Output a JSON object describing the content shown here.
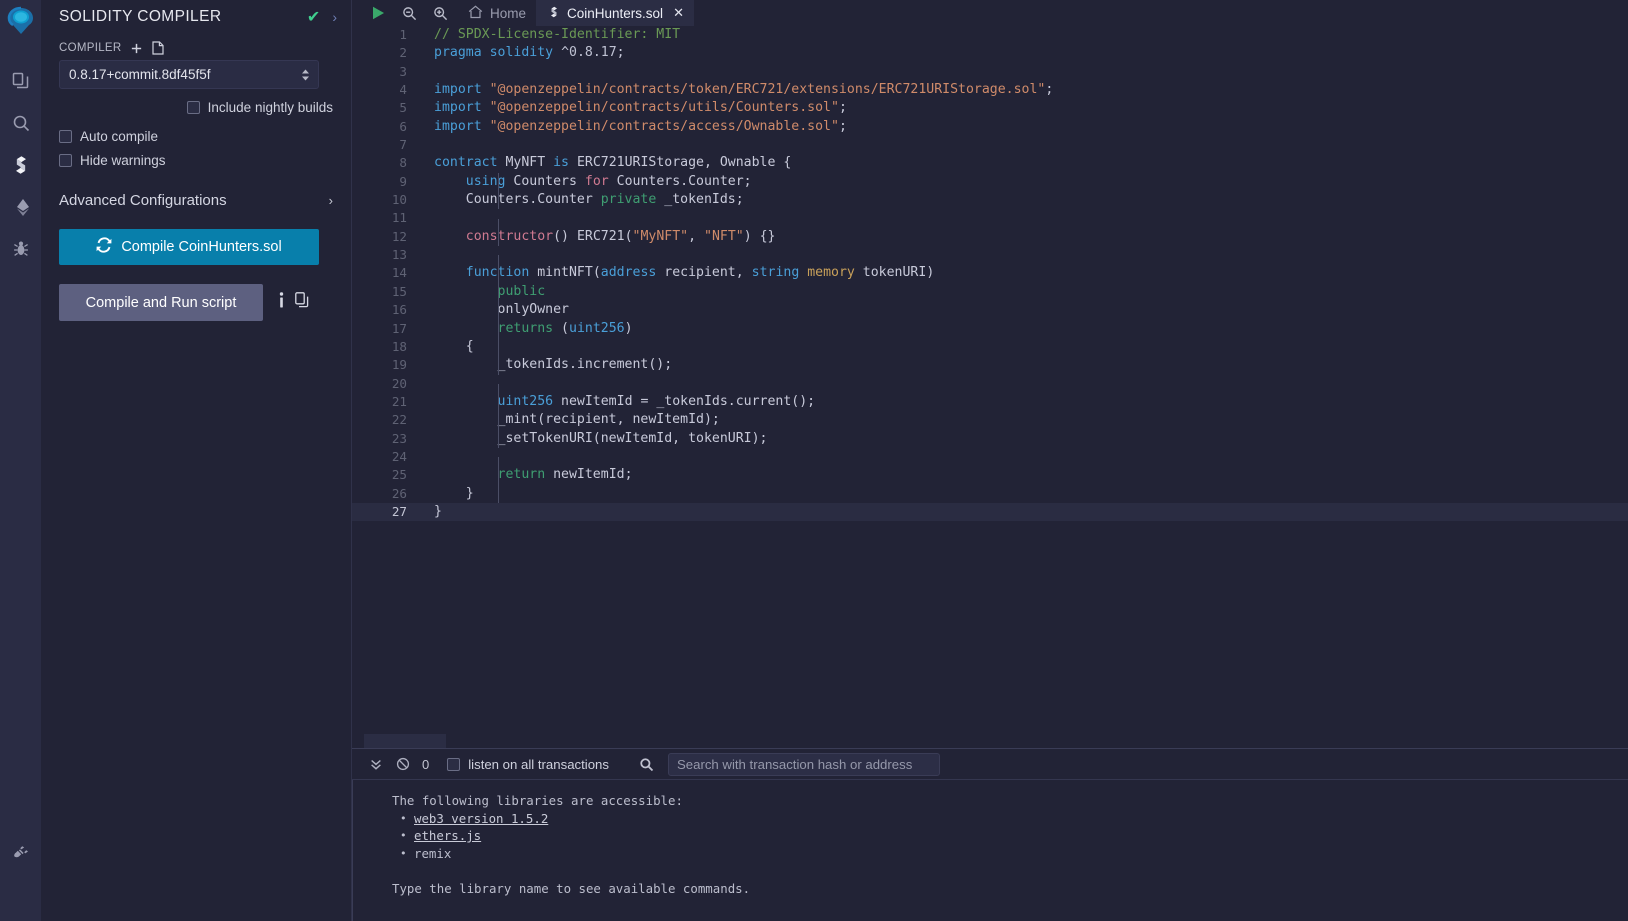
{
  "rail": {
    "logo": "remix-logo",
    "items": [
      {
        "name": "file-explorer-icon",
        "title": "File explorer"
      },
      {
        "name": "search-icon",
        "title": "Search in files"
      },
      {
        "name": "solidity-compiler-icon",
        "title": "Solidity compiler"
      },
      {
        "name": "deploy-run-icon",
        "title": "Deploy & run transactions"
      },
      {
        "name": "debugger-icon",
        "title": "Debugger"
      }
    ],
    "bottom": {
      "name": "plugin-manager-icon",
      "title": "Plugin manager"
    }
  },
  "panel": {
    "title": "SOLIDITY COMPILER",
    "status_check": "✔",
    "expand_chevron": "›",
    "compiler_label": "COMPILER",
    "add_icon": "+",
    "file_icon": "document-icon",
    "compiler_version": "0.8.17+commit.8df45f5f",
    "nightly_label": "Include nightly builds",
    "auto_compile_label": "Auto compile",
    "hide_warnings_label": "Hide warnings",
    "advanced_label": "Advanced Configurations",
    "advanced_chevron": "›",
    "compile_button": "Compile CoinHunters.sol",
    "run_script_button": "Compile and Run script",
    "info_icon": "info-icon",
    "copy_icon": "copy-icon"
  },
  "toolbar": {
    "run_icon": "play-icon",
    "zoom_out_icon": "zoom-out-icon",
    "zoom_in_icon": "zoom-in-icon",
    "tabs": [
      {
        "label": "Home",
        "icon": "home-icon",
        "active": false,
        "closable": false
      },
      {
        "label": "CoinHunters.sol",
        "icon": "solidity-file-icon",
        "active": true,
        "closable": true,
        "close": "✕"
      }
    ]
  },
  "editor": {
    "active_line": 27,
    "lines": [
      {
        "n": 1,
        "tokens": [
          {
            "t": "com",
            "v": "// SPDX-License-Identifier: MIT"
          }
        ]
      },
      {
        "n": 2,
        "tokens": [
          {
            "t": "kw",
            "v": "pragma"
          },
          {
            "t": "plain",
            "v": " "
          },
          {
            "t": "kw",
            "v": "solidity"
          },
          {
            "t": "plain",
            "v": " "
          },
          {
            "t": "num",
            "v": "^0.8.17"
          },
          {
            "t": "punc",
            "v": ";"
          }
        ]
      },
      {
        "n": 3,
        "tokens": []
      },
      {
        "n": 4,
        "tokens": [
          {
            "t": "kw",
            "v": "import"
          },
          {
            "t": "plain",
            "v": " "
          },
          {
            "t": "str",
            "v": "\"@openzeppelin/contracts/token/ERC721/extensions/ERC721URIStorage.sol\""
          },
          {
            "t": "punc",
            "v": ";"
          }
        ]
      },
      {
        "n": 5,
        "tokens": [
          {
            "t": "kw",
            "v": "import"
          },
          {
            "t": "plain",
            "v": " "
          },
          {
            "t": "str",
            "v": "\"@openzeppelin/contracts/utils/Counters.sol\""
          },
          {
            "t": "punc",
            "v": ";"
          }
        ]
      },
      {
        "n": 6,
        "tokens": [
          {
            "t": "kw",
            "v": "import"
          },
          {
            "t": "plain",
            "v": " "
          },
          {
            "t": "str",
            "v": "\"@openzeppelin/contracts/access/Ownable.sol\""
          },
          {
            "t": "punc",
            "v": ";"
          }
        ]
      },
      {
        "n": 7,
        "tokens": []
      },
      {
        "n": 8,
        "tokens": [
          {
            "t": "kw",
            "v": "contract"
          },
          {
            "t": "plain",
            "v": " MyNFT "
          },
          {
            "t": "kw",
            "v": "is"
          },
          {
            "t": "plain",
            "v": " ERC721URIStorage, Ownable {"
          }
        ]
      },
      {
        "n": 9,
        "indent": 1,
        "tokens": [
          {
            "t": "plain",
            "v": "    "
          },
          {
            "t": "kw",
            "v": "using"
          },
          {
            "t": "plain",
            "v": " Counters "
          },
          {
            "t": "kw3",
            "v": "for"
          },
          {
            "t": "plain",
            "v": " Counters.Counter;"
          }
        ]
      },
      {
        "n": 10,
        "indent": 1,
        "tokens": [
          {
            "t": "plain",
            "v": "    Counters.Counter "
          },
          {
            "t": "kw2",
            "v": "private"
          },
          {
            "t": "plain",
            "v": " _tokenIds;"
          }
        ]
      },
      {
        "n": 11,
        "indent": 1,
        "tokens": []
      },
      {
        "n": 12,
        "indent": 1,
        "tokens": [
          {
            "t": "plain",
            "v": "    "
          },
          {
            "t": "kw3",
            "v": "constructor"
          },
          {
            "t": "punc",
            "v": "()"
          },
          {
            "t": "plain",
            "v": " ERC721("
          },
          {
            "t": "str",
            "v": "\"MyNFT\""
          },
          {
            "t": "plain",
            "v": ", "
          },
          {
            "t": "str",
            "v": "\"NFT\""
          },
          {
            "t": "plain",
            "v": ") {}"
          }
        ]
      },
      {
        "n": 13,
        "indent": 1,
        "tokens": []
      },
      {
        "n": 14,
        "indent": 1,
        "tokens": [
          {
            "t": "plain",
            "v": "    "
          },
          {
            "t": "kw",
            "v": "function"
          },
          {
            "t": "plain",
            "v": " mintNFT("
          },
          {
            "t": "typ",
            "v": "address"
          },
          {
            "t": "plain",
            "v": " recipient, "
          },
          {
            "t": "typ",
            "v": "string"
          },
          {
            "t": "plain",
            "v": " "
          },
          {
            "t": "mem",
            "v": "memory"
          },
          {
            "t": "plain",
            "v": " tokenURI)"
          }
        ]
      },
      {
        "n": 15,
        "indent": 2,
        "tokens": [
          {
            "t": "plain",
            "v": "        "
          },
          {
            "t": "kw2",
            "v": "public"
          }
        ]
      },
      {
        "n": 16,
        "indent": 2,
        "tokens": [
          {
            "t": "plain",
            "v": "        onlyOwner"
          }
        ]
      },
      {
        "n": 17,
        "indent": 2,
        "tokens": [
          {
            "t": "plain",
            "v": "        "
          },
          {
            "t": "kw2",
            "v": "returns"
          },
          {
            "t": "plain",
            "v": " ("
          },
          {
            "t": "typ",
            "v": "uint256"
          },
          {
            "t": "plain",
            "v": ")"
          }
        ]
      },
      {
        "n": 18,
        "indent": 1,
        "tokens": [
          {
            "t": "plain",
            "v": "    {"
          }
        ]
      },
      {
        "n": 19,
        "indent": 2,
        "tokens": [
          {
            "t": "plain",
            "v": "        _tokenIds.increment();"
          }
        ]
      },
      {
        "n": 20,
        "indent": 2,
        "tokens": []
      },
      {
        "n": 21,
        "indent": 2,
        "tokens": [
          {
            "t": "plain",
            "v": "        "
          },
          {
            "t": "typ",
            "v": "uint256"
          },
          {
            "t": "plain",
            "v": " newItemId = _tokenIds.current();"
          }
        ]
      },
      {
        "n": 22,
        "indent": 2,
        "tokens": [
          {
            "t": "plain",
            "v": "        _mint(recipient, newItemId);"
          }
        ]
      },
      {
        "n": 23,
        "indent": 2,
        "tokens": [
          {
            "t": "plain",
            "v": "        _setTokenURI(newItemId, tokenURI);"
          }
        ]
      },
      {
        "n": 24,
        "indent": 2,
        "tokens": []
      },
      {
        "n": 25,
        "indent": 2,
        "tokens": [
          {
            "t": "plain",
            "v": "        "
          },
          {
            "t": "kw2",
            "v": "return"
          },
          {
            "t": "plain",
            "v": " newItemId;"
          }
        ]
      },
      {
        "n": 26,
        "indent": 1,
        "tokens": [
          {
            "t": "plain",
            "v": "    }"
          }
        ]
      },
      {
        "n": 27,
        "tokens": [
          {
            "t": "plain",
            "v": "}"
          }
        ]
      }
    ]
  },
  "terminal": {
    "toggle_icon": "chevrons-down-icon",
    "clear_icon": "ban-icon",
    "count": "0",
    "listen_label": "listen on all transactions",
    "search_icon": "search-icon",
    "search_placeholder": "Search with transaction hash or address",
    "log": {
      "heading": "The following libraries are accessible:",
      "items": [
        {
          "text": "web3 version 1.5.2",
          "link": true
        },
        {
          "text": "ethers.js",
          "link": true
        },
        {
          "text": "remix",
          "link": false
        }
      ],
      "footer": "Type the library name to see available commands."
    }
  },
  "colors": {
    "accent": "#087fab",
    "panel_bg": "#222336",
    "rail_bg": "#2a2c44",
    "success": "#3fcf8e",
    "muted_button": "#5d6080"
  }
}
